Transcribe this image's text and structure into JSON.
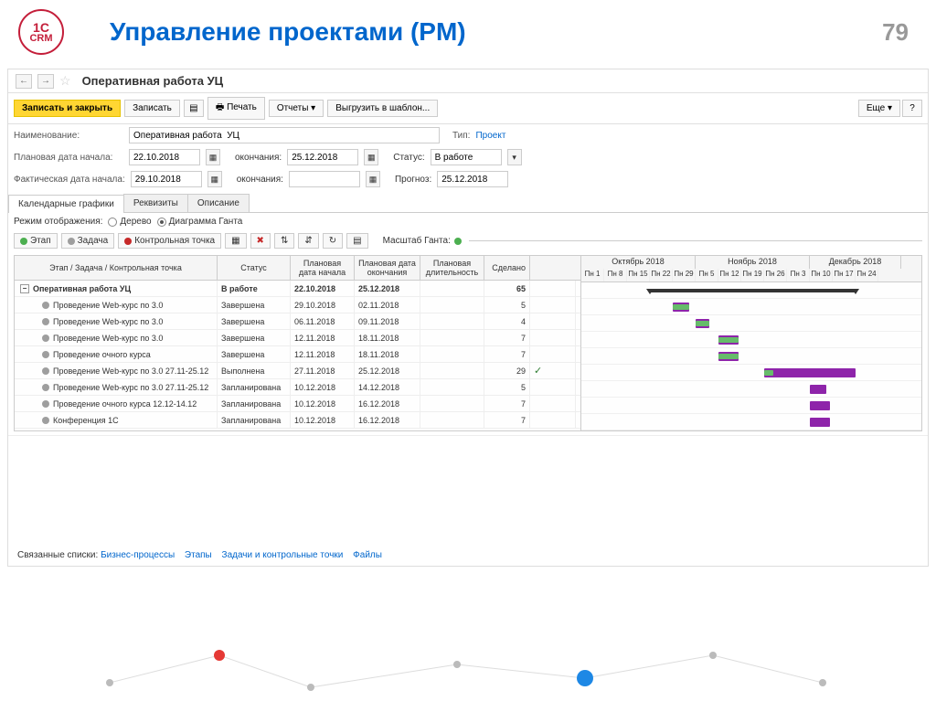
{
  "slide": {
    "title": "Управление проектами (PM)",
    "number": "79",
    "logo_top": "1C",
    "logo_bot": "CRM"
  },
  "window": {
    "title": "Оперативная работа  УЦ"
  },
  "toolbar": {
    "save_close": "Записать и закрыть",
    "save": "Записать",
    "print": "Печать",
    "reports": "Отчеты",
    "export": "Выгрузить в шаблон...",
    "more": "Еще"
  },
  "form": {
    "name_label": "Наименование:",
    "name_value": "Оперативная работа  УЦ",
    "type_label": "Тип:",
    "type_value": "Проект",
    "plan_start_label": "Плановая дата начала:",
    "plan_start": "22.10.2018",
    "end_label": "окончания:",
    "plan_end": "25.12.2018",
    "status_label": "Статус:",
    "status_value": "В работе",
    "fact_start_label": "Фактическая дата начала:",
    "fact_start": "29.10.2018",
    "fact_end": "",
    "forecast_label": "Прогноз:",
    "forecast": "25.12.2018"
  },
  "tabs": {
    "t1": "Календарные графики",
    "t2": "Реквизиты",
    "t3": "Описание"
  },
  "mode": {
    "label": "Режим отображения:",
    "tree": "Дерево",
    "gantt": "Диаграмма Ганта"
  },
  "actions": {
    "stage": "Этап",
    "task": "Задача",
    "milestone": "Контрольная точка",
    "scale": "Масштаб Ганта:"
  },
  "grid": {
    "h_task": "Этап / Задача / Контрольная точка",
    "h_status": "Статус",
    "h_start": "Плановая дата начала",
    "h_end": "Плановая дата окончания",
    "h_dur": "Плановая длительность",
    "h_done": "Сделано",
    "rows": [
      {
        "name": "Оперативная работа  УЦ",
        "status": "В работе",
        "start": "22.10.2018",
        "end": "25.12.2018",
        "dur": "",
        "done": "65",
        "bold": true,
        "expand": true
      },
      {
        "name": "Проведение Web-курс по 3.0",
        "status": "Завершена",
        "start": "29.10.2018",
        "end": "02.11.2018",
        "dur": "",
        "done": "5"
      },
      {
        "name": "Проведение Web-курс по 3.0",
        "status": "Завершена",
        "start": "06.11.2018",
        "end": "09.11.2018",
        "dur": "",
        "done": "4"
      },
      {
        "name": "Проведение Web-курс по 3.0",
        "status": "Завершена",
        "start": "12.11.2018",
        "end": "18.11.2018",
        "dur": "",
        "done": "7"
      },
      {
        "name": "Проведение очного курса",
        "status": "Завершена",
        "start": "12.11.2018",
        "end": "18.11.2018",
        "dur": "",
        "done": "7"
      },
      {
        "name": "Проведение Web-курс по 3.0 27.11-25.12",
        "status": "Выполнена",
        "start": "27.11.2018",
        "end": "25.12.2018",
        "dur": "",
        "done": "29",
        "check": true
      },
      {
        "name": "Проведение Web-курс по 3.0 27.11-25.12",
        "status": "Запланирована",
        "start": "10.12.2018",
        "end": "14.12.2018",
        "dur": "",
        "done": "5"
      },
      {
        "name": "Проведение очного курса 12.12-14.12",
        "status": "Запланирована",
        "start": "10.12.2018",
        "end": "16.12.2018",
        "dur": "",
        "done": "7"
      },
      {
        "name": "Конференция 1С",
        "status": "Запланирована",
        "start": "10.12.2018",
        "end": "16.12.2018",
        "dur": "",
        "done": "7"
      }
    ]
  },
  "gantt": {
    "months": [
      {
        "label": "Октябрь 2018",
        "span": 5
      },
      {
        "label": "Ноябрь 2018",
        "span": 5
      },
      {
        "label": "Декабрь 2018",
        "span": 4
      }
    ],
    "days": [
      "Пн 1",
      "Пн 8",
      "Пн 15",
      "Пн 22",
      "Пн 29",
      "Пн 5",
      "Пн 12",
      "Пн 19",
      "Пн 26",
      "Пн 3",
      "Пн 10",
      "Пн 17",
      "Пн 24"
    ]
  },
  "footer": {
    "label": "Связанные списки:",
    "l1": "Бизнес-процессы",
    "l2": "Этапы",
    "l3": "Задачи и контрольные точки",
    "l4": "Файлы"
  }
}
